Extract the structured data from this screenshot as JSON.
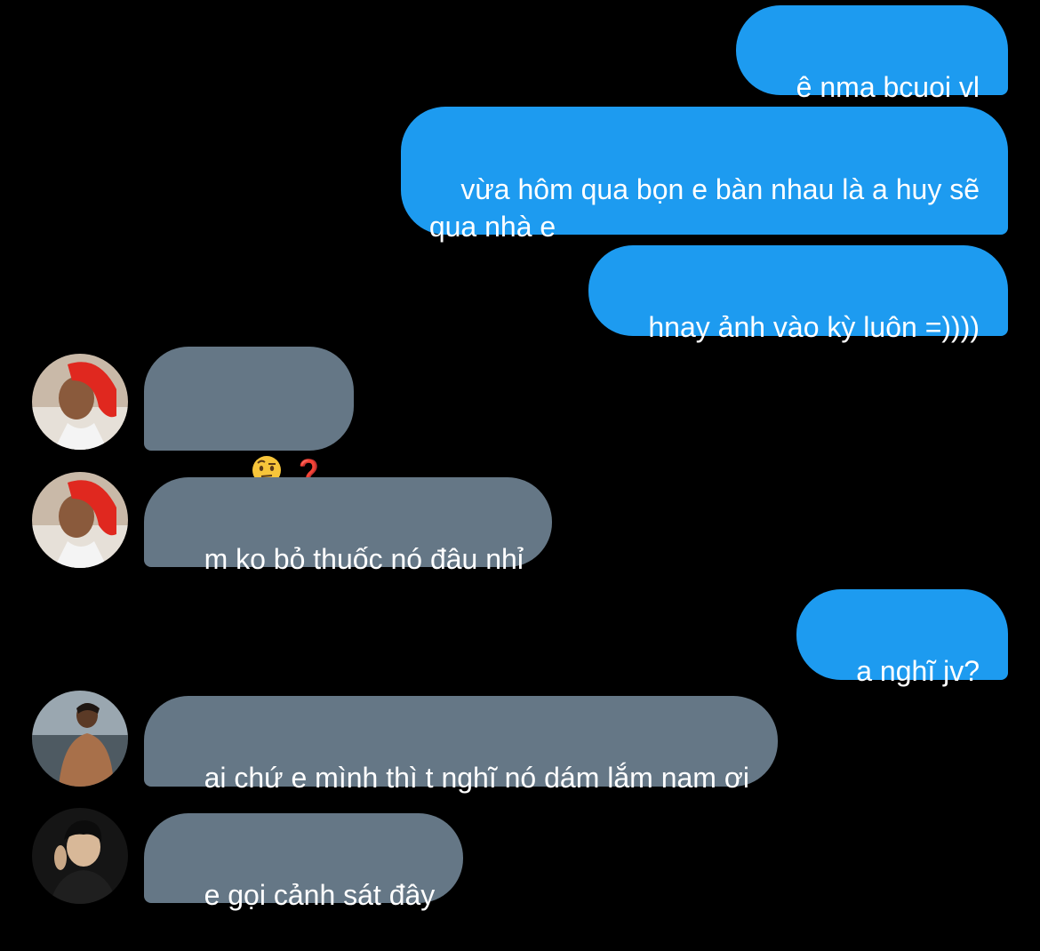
{
  "conversation": {
    "messages": [
      {
        "side": "out",
        "text": "ê nma bcuoi vl"
      },
      {
        "side": "out",
        "text": "vừa hôm qua bọn e bàn nhau là a huy sẽ\nqua nhà e"
      },
      {
        "side": "out",
        "text": "hnay ảnh vào kỳ luôn =))))"
      },
      {
        "side": "in",
        "avatar": "avatar-red-scarf",
        "emoji": "face-with-raised-eyebrow-emoji",
        "text": "❓"
      },
      {
        "side": "in",
        "avatar": "avatar-red-scarf",
        "text": "m ko bỏ thuốc nó đâu nhỉ"
      },
      {
        "side": "out",
        "text": "a nghĩ jv?"
      },
      {
        "side": "in",
        "avatar": "avatar-beach",
        "text": "ai chứ e mình thì t nghĩ nó dám lắm nam ơi"
      },
      {
        "side": "in",
        "avatar": "avatar-dark-portrait",
        "text": "e gọi cảnh sát đây"
      }
    ]
  },
  "colors": {
    "background": "#000000",
    "outgoing_bubble": "#1d9bf0",
    "incoming_bubble": "#657786",
    "text": "#ffffff"
  }
}
